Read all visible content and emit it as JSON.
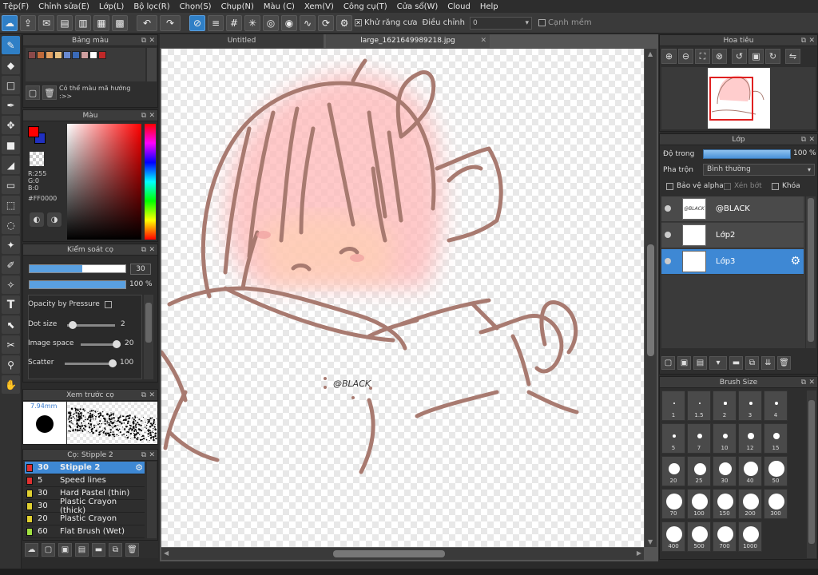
{
  "menu": [
    "Tệp(F)",
    "Chỉnh sửa(E)",
    "Lớp(L)",
    "Bộ lọc(R)",
    "Chọn(S)",
    "Chụp(N)",
    "Màu (C)",
    "Xem(V)",
    "Công cụ(T)",
    "Cửa sổ(W)",
    "Cloud",
    "Help"
  ],
  "toolbar": {
    "antialias_label": "Khử răng cưa",
    "correction_label": "Điều chỉnh",
    "correction_value": "0",
    "edge_label": "Cạnh mềm"
  },
  "palette": {
    "title": "Bảng màu",
    "hint": "Có thể màu mã hướng :>>",
    "swatches": [
      "#8b4a4a",
      "#c06a3a",
      "#e3a060",
      "#e8c080",
      "#6a8ad0",
      "#3a6ab8",
      "#d0a0a0",
      "#ffffff",
      "#c02828"
    ]
  },
  "color": {
    "title": "Màu",
    "fg": "#FF0000",
    "bg": "#2030c0",
    "r": "R:255",
    "g": "G:0",
    "b": "B:0",
    "hex": "#FF0000"
  },
  "brush_control": {
    "title": "Kiểm soát cọ",
    "size_value": "30",
    "size_fill": 0.55,
    "opacity_label": "100 %",
    "opacity_fill": 1.0,
    "opacity_pressure": "Opacity by Pressure",
    "dot_size_label": "Dot size",
    "dot_size_value": "2",
    "image_space_label": "Image space",
    "image_space_value": "20",
    "scatter_label": "Scatter",
    "scatter_value": "100"
  },
  "preview": {
    "title": "Xem trước cọ",
    "size_text": "7.94mm"
  },
  "brushlist": {
    "title": "Cọ: Stipple 2",
    "items": [
      {
        "num": "30",
        "name": "Stipple 2",
        "color": "#e03030",
        "selected": true
      },
      {
        "num": "5",
        "name": "Speed lines",
        "color": "#e03030"
      },
      {
        "num": "30",
        "name": "Hard Pastel (thin)",
        "color": "#e0d030"
      },
      {
        "num": "30",
        "name": "Plastic Crayon (thick)",
        "color": "#e0d030"
      },
      {
        "num": "20",
        "name": "Plastic Crayon",
        "color": "#e0d030"
      },
      {
        "num": "60",
        "name": "Flat Brush (Wet)",
        "color": "#a0e040"
      }
    ]
  },
  "canvas": {
    "tab1": "Untitled",
    "tab2": "large_1621649989218.jpg",
    "watermark": "@BLACK"
  },
  "navigator": {
    "title": "Hoa tiêu"
  },
  "layers": {
    "title": "Lớp",
    "opacity_label": "Độ trong",
    "opacity_value": "100 %",
    "opacity_fill": 1.0,
    "blend_label": "Pha trộn",
    "blend_value": "Bình thường",
    "protect_alpha": "Bảo vệ alpha",
    "clipping": "Xén bớt",
    "lock": "Khóa",
    "items": [
      {
        "name": "@BLACK",
        "thumb_text": "@BLACK"
      },
      {
        "name": "Lớp2"
      },
      {
        "name": "Lớp3",
        "selected": true
      }
    ]
  },
  "brush_size": {
    "title": "Brush Size",
    "sizes": [
      "1",
      "1.5",
      "2",
      "3",
      "4",
      "5",
      "7",
      "10",
      "12",
      "15",
      "20",
      "25",
      "30",
      "40",
      "50",
      "70",
      "100",
      "150",
      "200",
      "300",
      "400",
      "500",
      "700",
      "1000"
    ]
  }
}
